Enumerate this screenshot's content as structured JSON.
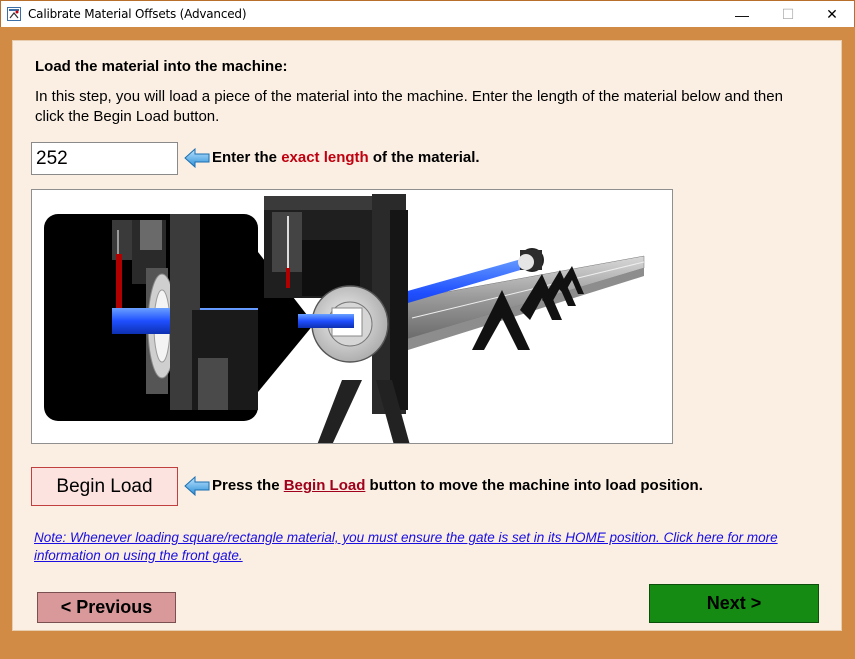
{
  "window": {
    "title": "Calibrate Material Offsets (Advanced)",
    "minimize_glyph": "—",
    "maximize_glyph": "☐",
    "close_glyph": "✕"
  },
  "step": {
    "heading": "Load the material into the machine:",
    "intro": "In this step, you will load a piece of the material into the machine. Enter the length of the material below and then click the Begin Load button."
  },
  "length": {
    "value": "252",
    "hint_prefix": "Enter the ",
    "hint_emphasis": "exact length",
    "hint_suffix": " of the material."
  },
  "begin_load": {
    "button_label": "Begin Load",
    "hint_prefix": "Press the ",
    "hint_link": "Begin Load",
    "hint_suffix": " button to move the machine into load position."
  },
  "note": {
    "text": "Note: Whenever loading square/rectangle material, you must ensure the gate is set in its HOME position. Click here for more information on using the front gate."
  },
  "navigation": {
    "previous_label": "< Previous",
    "next_label": "Next >"
  },
  "icons": {
    "app": "calibrate-app-icon",
    "hint_arrow": "left-arrow-icon"
  },
  "colors": {
    "frame": "#d28b45",
    "panel": "#fbefe3",
    "emphasis_red": "#c0000f",
    "next_green": "#168b14",
    "previous_pink": "#d9999b",
    "link_blue": "#1a0fe0",
    "material_blue": "#1f4fff"
  }
}
